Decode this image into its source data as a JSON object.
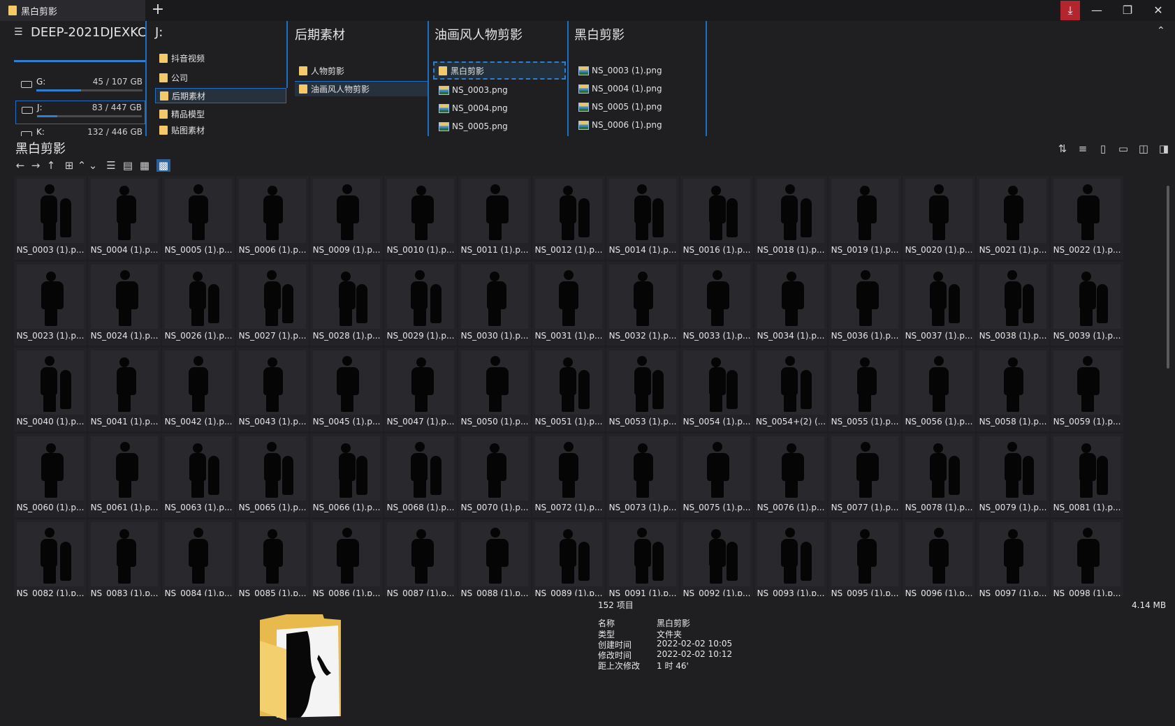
{
  "window": {
    "tab_title": "黑白剪影",
    "new_tab": "+",
    "download": "⤓",
    "minimize": "—",
    "restore": "❐",
    "close": "✕"
  },
  "columns": {
    "drive_header": "DEEP-2021DJEXKC",
    "drives": [
      {
        "name": "G:",
        "size": "45 / 107 GB",
        "used": 0.42
      },
      {
        "name": "J:",
        "size": "83 / 447 GB",
        "used": 0.19
      },
      {
        "name": "K:",
        "size": "132 / 446 GB",
        "used": 0.3
      }
    ],
    "j_header": "J:",
    "j_items": [
      "公司",
      "后期素材",
      "精品模型",
      "贴图素材"
    ],
    "j_partial": "抖音视频",
    "post_header": "后期素材",
    "post_items": [
      "人物剪影",
      "油画风人物剪影"
    ],
    "oil_header": "油画风人物剪影",
    "oil_items": [
      {
        "kind": "folder",
        "label": "黑白剪影"
      },
      {
        "kind": "image",
        "label": "NS_0003.png"
      },
      {
        "kind": "image",
        "label": "NS_0004.png"
      },
      {
        "kind": "image",
        "label": "NS_0005.png"
      }
    ],
    "bw_header": "黑白剪影",
    "bw_items": [
      "NS_0003 (1).png",
      "NS_0004 (1).png",
      "NS_0005 (1).png",
      "NS_0006 (1).png"
    ]
  },
  "path_title": "黑白剪影",
  "toolbar": {
    "back": "←",
    "forward": "→",
    "up": "↑",
    "new_folder": "⊞",
    "sort_up": "⌃",
    "sort_down": "⌄",
    "view_list": "☰",
    "view_details": "▤",
    "view_tiles": "▦",
    "view_icons": "▩"
  },
  "right_toolbar": [
    "⇅",
    "≡",
    "▯",
    "▭",
    "◫",
    "◨"
  ],
  "files": [
    "NS_0003 (1).p...",
    "NS_0004 (1).p...",
    "NS_0005 (1).p...",
    "NS_0006 (1).p...",
    "NS_0009 (1).p...",
    "NS_0010 (1).p...",
    "NS_0011 (1).p...",
    "NS_0012 (1).p...",
    "NS_0014 (1).p...",
    "NS_0016 (1).p...",
    "NS_0018 (1).p...",
    "NS_0019 (1).p...",
    "NS_0020 (1).p...",
    "NS_0021 (1).p...",
    "NS_0022 (1).p...",
    "NS_0023 (1).p...",
    "NS_0024 (1).p...",
    "NS_0026 (1).p...",
    "NS_0027 (1).p...",
    "NS_0028 (1).p...",
    "NS_0029 (1).p...",
    "NS_0030 (1).p...",
    "NS_0031 (1).p...",
    "NS_0032 (1).p...",
    "NS_0033 (1).p...",
    "NS_0034 (1).p...",
    "NS_0036 (1).p...",
    "NS_0037 (1).p...",
    "NS_0038 (1).p...",
    "NS_0039 (1).p...",
    "NS_0040 (1).p...",
    "NS_0041 (1).p...",
    "NS_0042 (1).p...",
    "NS_0043 (1).p...",
    "NS_0045 (1).p...",
    "NS_0047 (1).p...",
    "NS_0050 (1).p...",
    "NS_0051 (1).p...",
    "NS_0053 (1).p...",
    "NS_0054 (1).p...",
    "NS_0054+(2) (...",
    "NS_0055 (1).p...",
    "NS_0056 (1).p...",
    "NS_0058 (1).p...",
    "NS_0059 (1).p...",
    "NS_0060 (1).p...",
    "NS_0061 (1).p...",
    "NS_0063 (1).p...",
    "NS_0065 (1).p...",
    "NS_0066 (1).p...",
    "NS_0068 (1).p...",
    "NS_0070 (1).p...",
    "NS_0072 (1).p...",
    "NS_0073 (1).p...",
    "NS_0075 (1).p...",
    "NS_0076 (1).p...",
    "NS_0077 (1).p...",
    "NS_0078 (1).p...",
    "NS_0079 (1).p...",
    "NS_0081 (1).p...",
    "NS_0082 (1).p...",
    "NS_0083 (1).p...",
    "NS_0084 (1).p...",
    "NS_0085 (1).p...",
    "NS_0086 (1).p...",
    "NS_0087 (1).p...",
    "NS_0088 (1).p...",
    "NS_0089 (1).p...",
    "NS_0091 (1).p...",
    "NS_0092 (1).p...",
    "NS_0093 (1).p...",
    "NS_0095 (1).p...",
    "NS_0096 (1).p...",
    "NS_0097 (1).p...",
    "NS_0098 (1).p..."
  ],
  "details": {
    "count": "152 项目",
    "size": "4.14 MB",
    "rows": [
      {
        "k": "名称",
        "v": "黑白剪影"
      },
      {
        "k": "类型",
        "v": "文件夹"
      },
      {
        "k": "创建时间",
        "v": "2022-02-02  10:05"
      },
      {
        "k": "修改时间",
        "v": "2022-02-02  10:12"
      },
      {
        "k": "距上次修改",
        "v": "1 时 46'"
      }
    ]
  },
  "colors": {
    "accent": "#1c6fc4",
    "folder": "#f3c969",
    "download": "#b3262e"
  }
}
